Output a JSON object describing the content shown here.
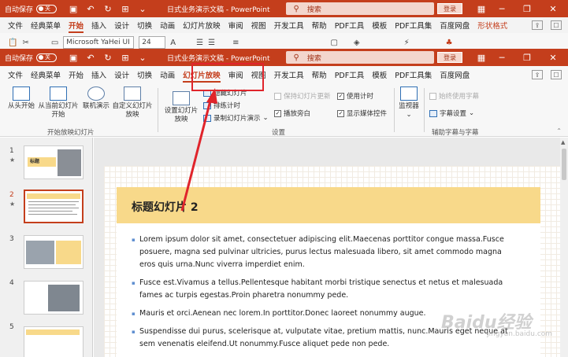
{
  "window_back": {
    "autosave_label": "自动保存",
    "toggle_state": "关",
    "title": "日式业务演示文稿 - PowerPoint",
    "search_placeholder": "搜索",
    "login_label": "登录",
    "tabs": [
      "文件",
      "经典菜单",
      "开始",
      "插入",
      "设计",
      "切换",
      "动画",
      "幻灯片放映",
      "审阅",
      "视图",
      "开发工具",
      "帮助",
      "PDF工具",
      "模板",
      "PDF工具集",
      "百度网盘",
      "形状格式"
    ],
    "active_tab": "开始",
    "font_name": "Microsoft YaHei UI",
    "font_size": "24"
  },
  "window_front": {
    "autosave_label": "自动保存",
    "toggle_state": "关",
    "title": "日式业务演示文稿 - PowerPoint",
    "search_placeholder": "搜索",
    "login_label": "登录",
    "tabs": [
      "文件",
      "经典菜单",
      "开始",
      "插入",
      "设计",
      "切换",
      "动画",
      "幻灯片放映",
      "审阅",
      "视图",
      "开发工具",
      "帮助",
      "PDF工具",
      "模板",
      "PDF工具集",
      "百度网盘"
    ],
    "active_tab": "幻灯片放映"
  },
  "ribbon": {
    "from_start": "从头开始",
    "from_current": "从当前幻灯片开始",
    "online_present": "联机演示",
    "custom_show": "自定义幻灯片放映",
    "group_start": "开始放映幻灯片",
    "setup_show": "设置幻灯片放映",
    "hide_slide": "隐藏幻灯片",
    "rehearse": "排练计时",
    "record": "录制幻灯片演示",
    "keep_updated": "保持幻灯片更新",
    "play_narration": "播放旁白",
    "use_timings": "使用计时",
    "show_media": "显示媒体控件",
    "group_setup": "设置",
    "monitor": "监视器",
    "always_subtitles": "始终使用字幕",
    "subtitle_settings": "字幕设置",
    "group_captions": "辅助字幕与字幕"
  },
  "slides": [
    {
      "number": "1",
      "star": "★",
      "thumb_title": "标题"
    },
    {
      "number": "2",
      "star": "★"
    },
    {
      "number": "3"
    },
    {
      "number": "4"
    },
    {
      "number": "5"
    }
  ],
  "current_slide": {
    "title": "标题幻灯片 2",
    "bullets": [
      "Lorem ipsum dolor sit amet, consectetuer adipiscing elit.Maecenas porttitor congue massa.Fusce posuere, magna sed pulvinar ultricies, purus lectus malesuada libero, sit amet commodo magna eros quis urna.Nunc viverra imperdiet enim.",
      "Fusce est.Vivamus a tellus.Pellentesque habitant morbi tristique senectus et netus et malesuada fames ac turpis egestas.Proin pharetra nonummy pede.",
      "Mauris et orci.Aenean nec lorem.In porttitor.Donec laoreet nonummy augue.",
      "Suspendisse dui purus, scelerisque at, vulputate vitae, pretium mattis, nunc.Mauris eget neque at sem venenatis eleifend.Ut nonummy.Fusce aliquet pede non pede."
    ]
  },
  "watermark": {
    "text": "Baidu经验",
    "sub": "jingyan.baidu.com"
  },
  "colors": {
    "accent": "#c43e1c",
    "highlight": "#e0242b",
    "slide_title_bg": "#f8d98a"
  }
}
